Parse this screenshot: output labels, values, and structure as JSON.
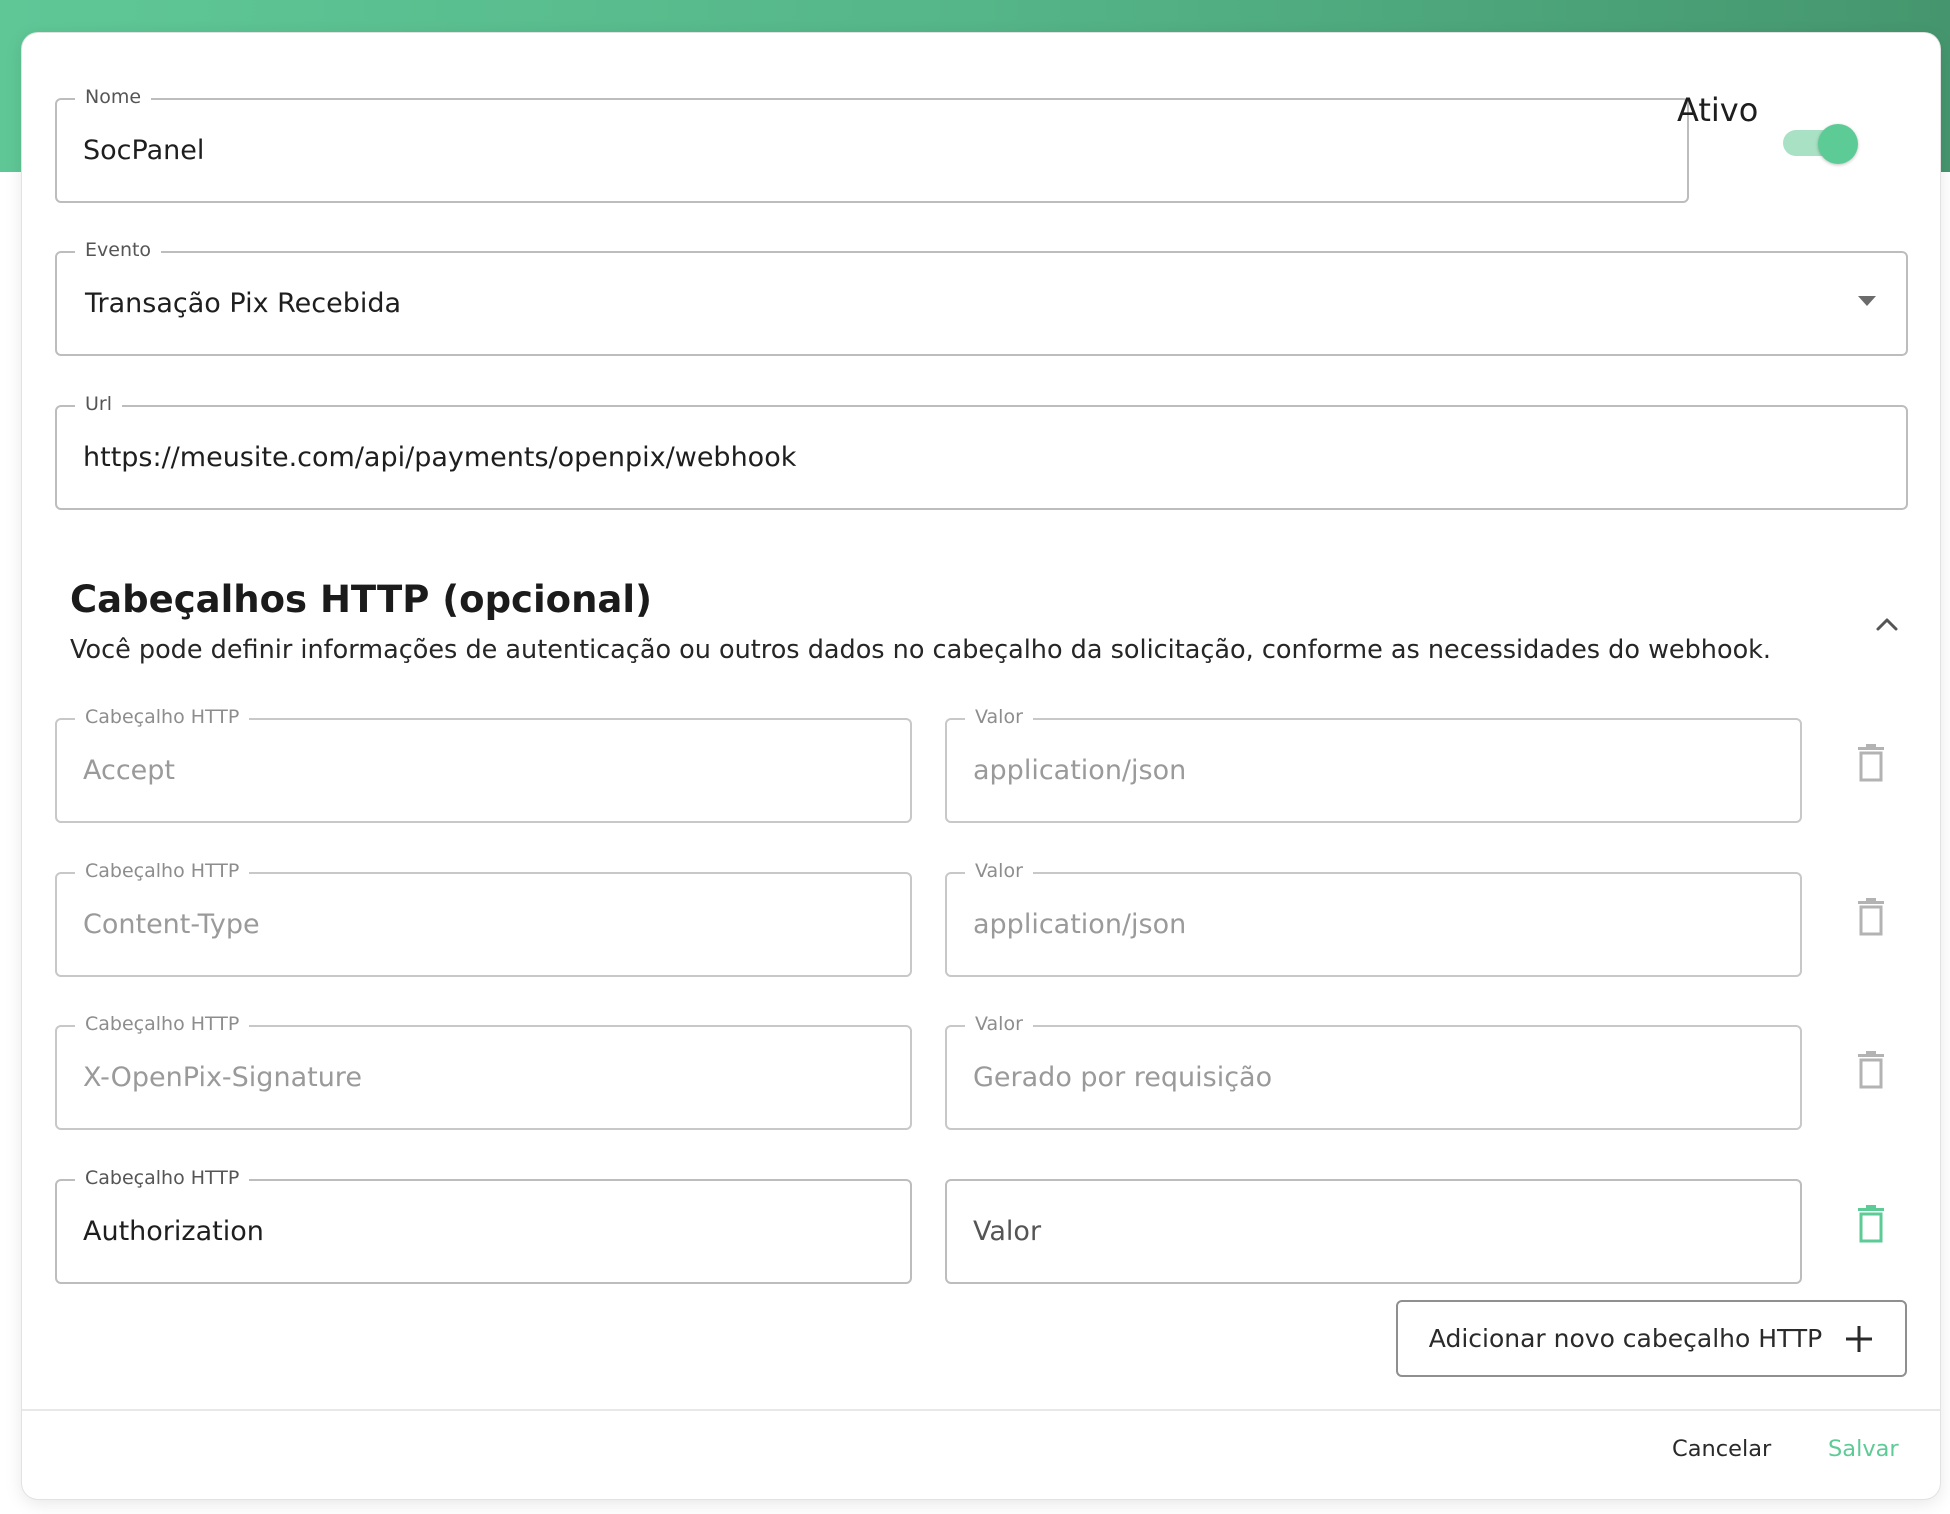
{
  "form": {
    "name": {
      "label": "Nome",
      "value": "SocPanel"
    },
    "active": {
      "label": "Ativo",
      "on": true
    },
    "event": {
      "label": "Evento",
      "value": "Transação Pix Recebida"
    },
    "url": {
      "label": "Url",
      "value": "https://meusite.com/api/payments/openpix/webhook"
    }
  },
  "headers_section": {
    "title": "Cabeçalhos HTTP (opcional)",
    "description": "Você pode definir informações de autenticação ou outros dados no cabeçalho da solicitação, conforme as necessidades do webhook.",
    "rows": [
      {
        "key_label": "Cabeçalho HTTP",
        "key": "Accept",
        "value_label": "Valor",
        "value": "application/json"
      },
      {
        "key_label": "Cabeçalho HTTP",
        "key": "Content-Type",
        "value_label": "Valor",
        "value": "application/json"
      },
      {
        "key_label": "Cabeçalho HTTP",
        "key": "X-OpenPix-Signature",
        "value_label": "Valor",
        "value": "Gerado por requisição"
      },
      {
        "key_label": "Cabeçalho HTTP",
        "key": "Authorization",
        "value_placeholder": "Valor"
      }
    ],
    "add_button_label": "Adicionar novo cabeçalho HTTP"
  },
  "footer": {
    "cancel_label": "Cancelar",
    "save_label": "Salvar"
  },
  "colors": {
    "accent": "#5dcb96",
    "header_gradient_start": "#5fc796",
    "header_gradient_end": "#45966e",
    "disabled_icon": "#b3b3b3"
  },
  "icons": {
    "dropdown": "caret-down-icon",
    "collapse": "chevron-up-icon",
    "delete": "trash-icon",
    "add": "plus-icon"
  }
}
